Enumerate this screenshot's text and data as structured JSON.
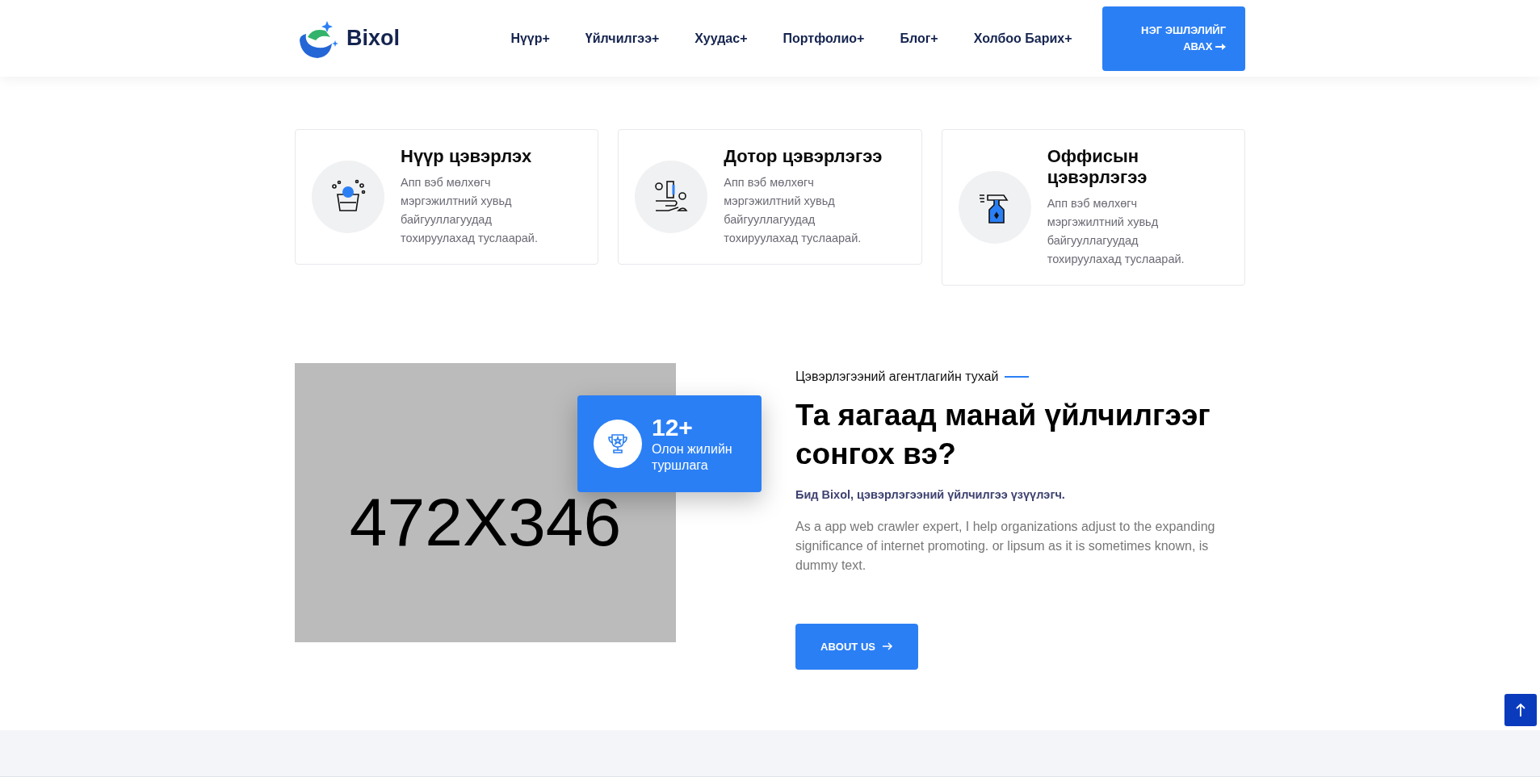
{
  "header": {
    "logo": "Bixol",
    "nav": [
      {
        "label": "Нүүр",
        "plus": "+"
      },
      {
        "label": "Үйлчилгээ",
        "plus": "+"
      },
      {
        "label": "Хуудас",
        "plus": "+"
      },
      {
        "label": "Портфолио",
        "plus": "+"
      },
      {
        "label": "Блог",
        "plus": "+"
      },
      {
        "label": "Холбоо Барих",
        "plus": "+"
      }
    ],
    "cta": "НЭГ ЭШЛЭЛИЙГ АВАХ"
  },
  "services": [
    {
      "kind": "bucket",
      "title": "Нүүр цэвэрлэх",
      "text": "Апп вэб мөлхөгч мэргэжилтний хувьд байгууллагуудад тохируулахад туслаарай."
    },
    {
      "kind": "brush",
      "title": "Дотор цэвэрлэгээ",
      "text": "Апп вэб мөлхөгч мэргэжилтний хувьд байгууллагуудад тохируулахад туслаарай."
    },
    {
      "kind": "spray",
      "title": "Оффисын цэвэрлэгээ",
      "text": "Апп вэб мөлхөгч мэргэжилтний хувьд байгууллагуудад тохируулахад туслаарай."
    }
  ],
  "about": {
    "placeholder_text": "472X346",
    "badge": {
      "number": "12+",
      "label": "Олон жилийн туршлага"
    },
    "eyebrow": "Цэвэрлэгээний агентлагийн тухай",
    "heading": "Та яагаад манай үйлчилгээг сонгох вэ?",
    "lead": "Бид Bixol, цэвэрлэгээний үйлчилгээ үзүүлэгч.",
    "body": "As a app web crawler expert, I help organizations adjust to the expanding significance of internet promoting. or lipsum as it is sometimes known, is dummy text.",
    "button": "ABOUT US"
  }
}
